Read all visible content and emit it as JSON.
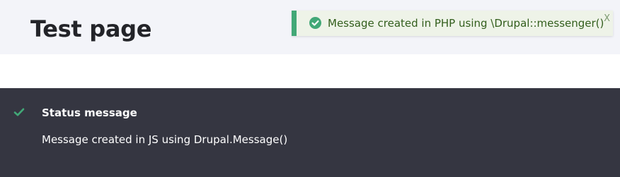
{
  "header": {
    "title": "Test page"
  },
  "toast": {
    "icon": "check-circle-icon",
    "message": "Message created in PHP using \\Drupal::messenger()",
    "close_label": "X",
    "accent_color": "#42a877"
  },
  "status": {
    "icon": "checkmark-icon",
    "title": "Status message",
    "message": "Message created in JS using Drupal.Message()",
    "accent_color": "#42a877"
  }
}
